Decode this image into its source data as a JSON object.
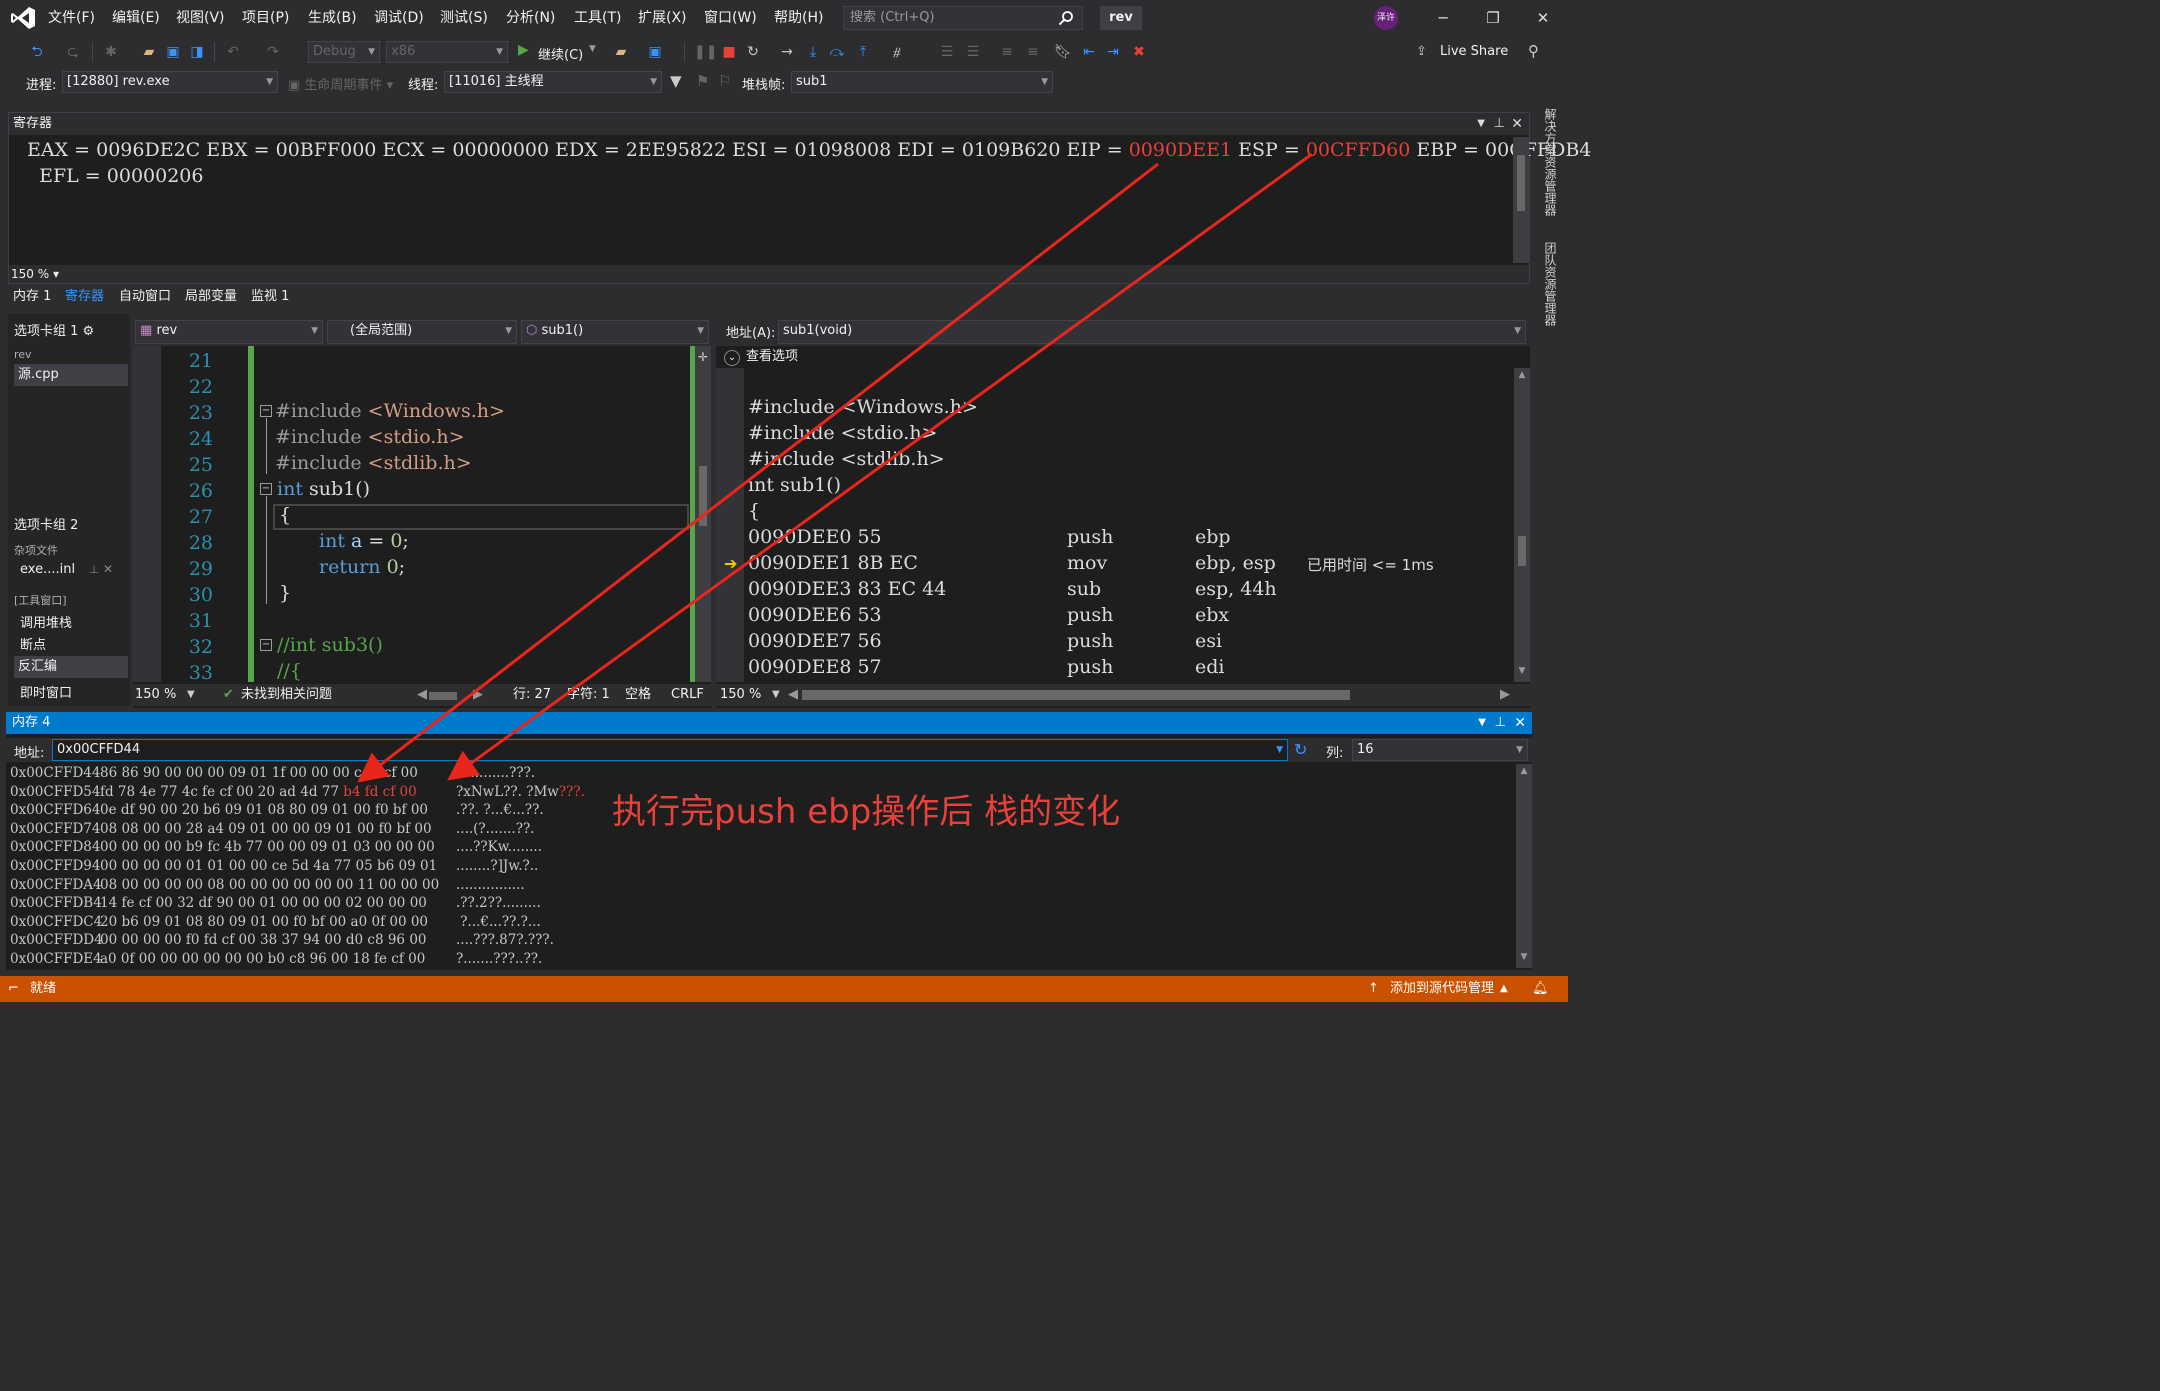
{
  "menu": [
    "文件(F)",
    "编辑(E)",
    "视图(V)",
    "项目(P)",
    "生成(B)",
    "调试(D)",
    "测试(S)",
    "分析(N)",
    "工具(T)",
    "扩展(X)",
    "窗口(W)",
    "帮助(H)"
  ],
  "search": {
    "placeholder": "搜索 (Ctrl+Q)"
  },
  "solution_name": "rev",
  "user_initials": "泽许",
  "toolbar": {
    "config": "Debug",
    "platform": "x86",
    "continue_label": "继续(C)",
    "live_share": "Live Share"
  },
  "debug_location": {
    "process_label": "进程:",
    "process_value": "[12880] rev.exe",
    "lifecycle_label": "生命周期事件",
    "thread_label": "线程:",
    "thread_value": "[11016] 主线程",
    "stackframe_label": "堆栈帧:",
    "stackframe_value": "sub1"
  },
  "registers": {
    "title": "寄存器",
    "EAX": "0096DE2C",
    "EBX": "00BFF000",
    "ECX": "00000000",
    "EDX": "2EE95822",
    "ESI": "01098008",
    "EDI": "0109B620",
    "EIP": "0090DEE1",
    "ESP": "00CFFD60",
    "EBP": "00CFFDB4",
    "EFL": "00000206",
    "zoom": "150 %",
    "changed_color": "#e8413a"
  },
  "debug_tabs": [
    "内存 1",
    "寄存器",
    "自动窗口",
    "局部变量",
    "监视 1"
  ],
  "active_debug_tab": "寄存器",
  "right_strip": [
    "解决方案资源管理器",
    "团队资源管理器"
  ],
  "tab_groups": {
    "group1": "选项卡组 1",
    "project": "rev",
    "file1": "源.cpp",
    "group2": "选项卡组 2",
    "misc_label": "杂项文件",
    "file2": "exe....inl",
    "tool_label": "[工具窗口]",
    "tools": [
      "调用堆栈",
      "断点",
      "反汇编",
      "即时窗口"
    ],
    "selected_tool": "反汇编"
  },
  "editor": {
    "project_combo": "rev",
    "scope_combo": "(全局范围)",
    "function_combo": "sub1()",
    "line_numbers": [
      "21",
      "22",
      "23",
      "24",
      "25",
      "26",
      "27",
      "28",
      "29",
      "30",
      "31",
      "32",
      "33"
    ],
    "lines": {
      "l23_a": "#include",
      "l23_b": "<Windows.h>",
      "l24_a": "#include",
      "l24_b": "<stdio.h>",
      "l25_a": "#include",
      "l25_b": "<stdlib.h>",
      "l26_a": "int",
      "l26_b": " sub1()",
      "l27": "{",
      "l28_a": "int",
      "l28_b": " a",
      "l28_c": " = ",
      "l28_d": "0",
      "l28_e": ";",
      "l29_a": "return",
      "l29_b": " ",
      "l29_c": "0",
      "l29_d": ";",
      "l30": "}",
      "l32": "//int sub3()",
      "l33": "//{"
    },
    "zoom": "150 %",
    "issues": "未找到相关问题",
    "row": "行: 27",
    "char": "字符: 1",
    "space": "空格",
    "eol": "CRLF"
  },
  "disassembly": {
    "address_label": "地址(A):",
    "address_value": "sub1(void)",
    "view_options": "查看选项",
    "source": [
      "#include <Windows.h>",
      "#include <stdio.h>",
      "#include <stdlib.h>",
      "int sub1()",
      "{"
    ],
    "instructions": [
      {
        "addr": "0090DEE0",
        "bytes": "55",
        "op": "push",
        "args": "ebp",
        "note": ""
      },
      {
        "addr": "0090DEE1",
        "bytes": "8B EC",
        "op": "mov",
        "args": "ebp, esp",
        "note": "已用时间 <= 1ms"
      },
      {
        "addr": "0090DEE3",
        "bytes": "83 EC 44",
        "op": "sub",
        "args": "esp, 44h",
        "note": ""
      },
      {
        "addr": "0090DEE6",
        "bytes": "53",
        "op": "push",
        "args": "ebx",
        "note": ""
      },
      {
        "addr": "0090DEE7",
        "bytes": "56",
        "op": "push",
        "args": "esi",
        "note": ""
      },
      {
        "addr": "0090DEE8",
        "bytes": "57",
        "op": "push",
        "args": "edi",
        "note": ""
      }
    ],
    "zoom": "150 %"
  },
  "memory": {
    "title": "内存 4",
    "address_label": "地址:",
    "address_value": "0x00CFFD44",
    "column_label": "列:",
    "column_value": "16",
    "rows": [
      {
        "addr": "0x00CFFD44",
        "hex": "86 86 90 00 00 00 09 01 1f 00 00 00",
        "hexred": "",
        "hextail": " c fd cf 00",
        "ascii": "??.........???."
      },
      {
        "addr": "0x00CFFD54",
        "hex": "fd 78 4e 77 4c fe cf 00 20 ad 4d 77",
        "hexred": " b4 fd cf 00",
        "hextail": "",
        "ascii": "?xNwL??. ?Mw",
        "asciired": "???."
      },
      {
        "addr": "0x00CFFD64",
        "hex": "0e df 90 00 20 b6 09 01 08 80 09 01 00 f0 bf 00",
        "hexred": "",
        "hextail": "",
        "ascii": ".??. ?...€...??."
      },
      {
        "addr": "0x00CFFD74",
        "hex": "08 08 00 00 28 a4 09 01 00 00 09 01 00 f0 bf 00",
        "hexred": "",
        "hextail": "",
        "ascii": "....(?.......??."
      },
      {
        "addr": "0x00CFFD84",
        "hex": "00 00 00 00 b9 fc 4b 77 00 00 09 01 03 00 00 00",
        "hexred": "",
        "hextail": "",
        "ascii": "....??Kw........"
      },
      {
        "addr": "0x00CFFD94",
        "hex": "00 00 00 00 01 01 00 00 ce 5d 4a 77 05 b6 09 01",
        "hexred": "",
        "hextail": "",
        "ascii": "........?]Jw.?.."
      },
      {
        "addr": "0x00CFFDA4",
        "hex": "08 00 00 00 00 08 00 00 00 00 00 00 11 00 00 00",
        "hexred": "",
        "hextail": "",
        "ascii": "................"
      },
      {
        "addr": "0x00CFFDB4",
        "hex": "14 fe cf 00 32 df 90 00 01 00 00 00 02 00 00 00",
        "hexred": "",
        "hextail": "",
        "ascii": ".??.2??........."
      },
      {
        "addr": "0x00CFFDC4",
        "hex": "20 b6 09 01 08 80 09 01 00 f0 bf 00 a0 0f 00 00",
        "hexred": "",
        "hextail": "",
        "ascii": " ?...€...??.?..."
      },
      {
        "addr": "0x00CFFDD4",
        "hex": "00 00 00 00 f0 fd cf 00 38 37 94 00 d0 c8 96 00",
        "hexred": "",
        "hextail": "",
        "ascii": "....???.87?.???."
      },
      {
        "addr": "0x00CFFDE4",
        "hex": "a0 0f 00 00 00 00 00 00 b0 c8 96 00 18 fe cf 00",
        "hexred": "",
        "hextail": "",
        "ascii": "?.......???..??."
      }
    ]
  },
  "annotation": "执行完push ebp操作后 栈的变化",
  "status": {
    "ready": "就绪",
    "source_control": "添加到源代码管理"
  },
  "colors": {
    "accent": "#007acc",
    "status": "#ca5100",
    "arrow": "#e8261c"
  }
}
